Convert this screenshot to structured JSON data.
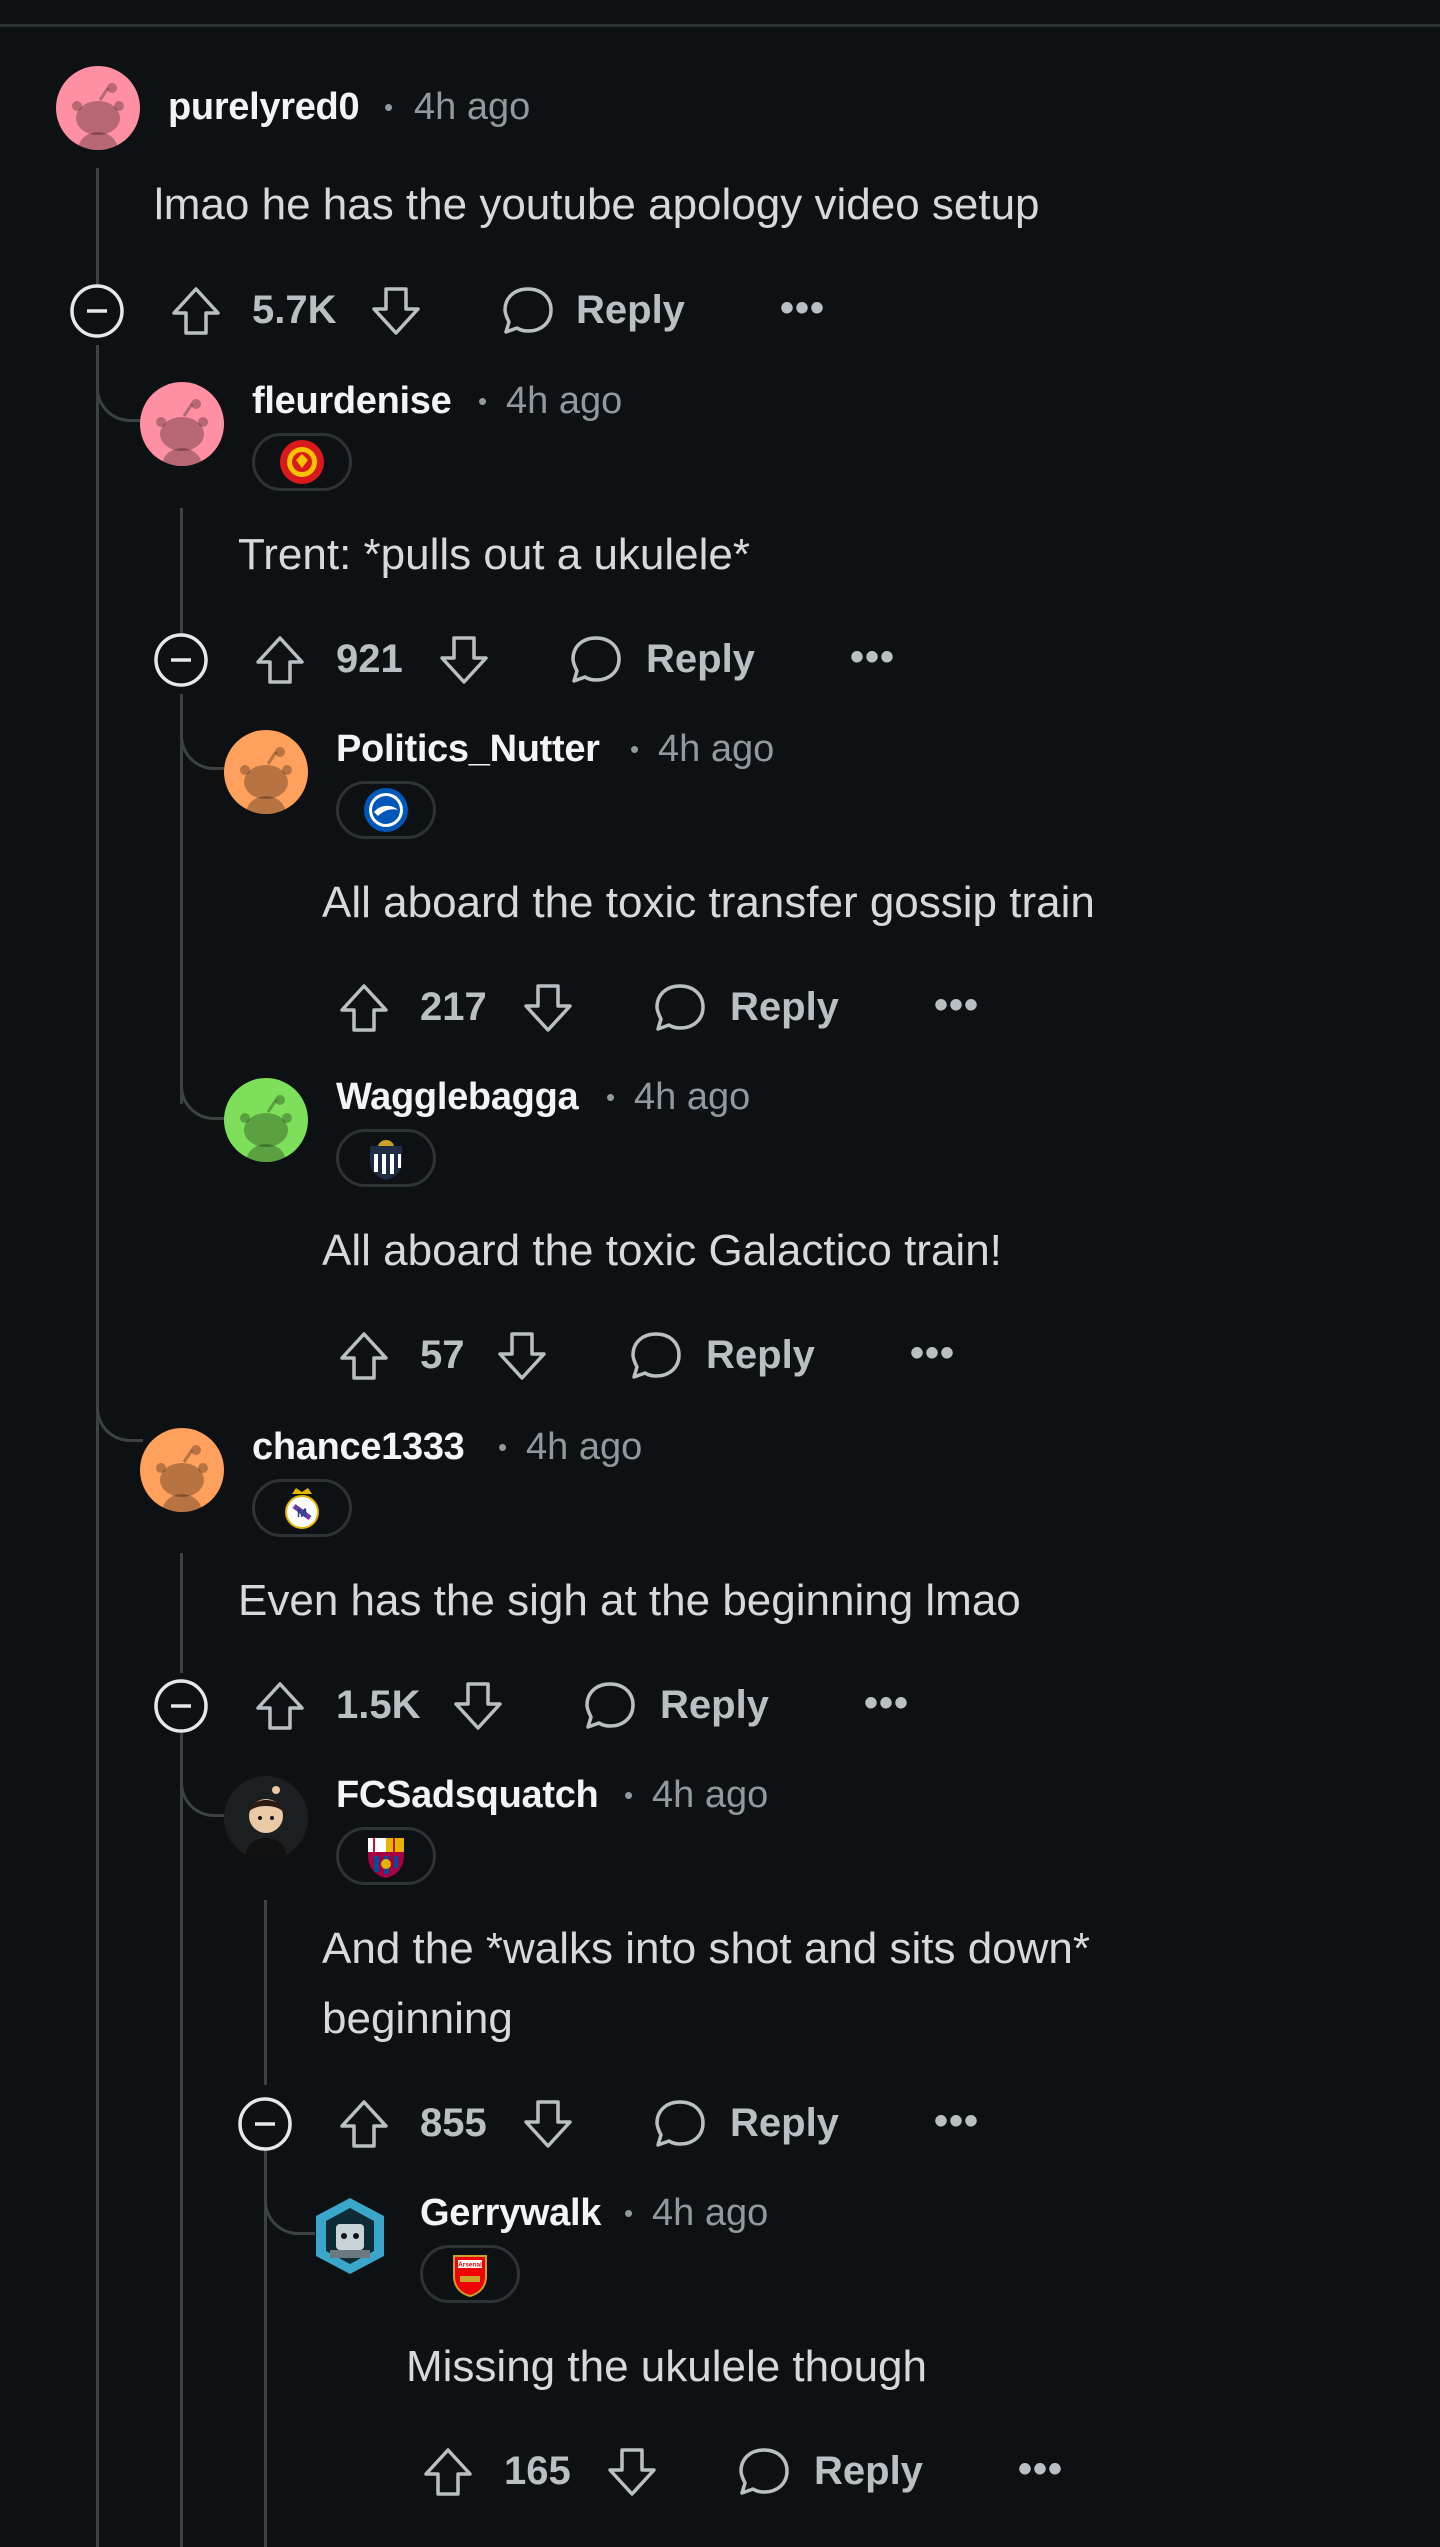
{
  "comments": [
    {
      "user": "purelyred0",
      "sep": "•",
      "time": "4h ago",
      "text": "lmao he has the youtube apology video setup",
      "votes": "5.7K",
      "reply": "Reply",
      "more": "•••",
      "avatar_color": "#ff8fa3",
      "flair": null
    },
    {
      "user": "fleurdenise",
      "sep": "•",
      "time": "4h ago",
      "text": "Trent: *pulls out a ukulele*",
      "votes": "921",
      "reply": "Reply",
      "more": "•••",
      "avatar_color": "#ff8fa3",
      "flair": "manchester-united-crest"
    },
    {
      "user": "Politics_Nutter",
      "sep": "•",
      "time": "4h ago",
      "text": "All aboard the toxic transfer gossip train",
      "votes": "217",
      "reply": "Reply",
      "more": "•••",
      "avatar_color": "#ffa05c",
      "flair": "brighton-crest"
    },
    {
      "user": "Wagglebagga",
      "sep": "•",
      "time": "4h ago",
      "text": "All aboard the toxic Galactico train!",
      "votes": "57",
      "reply": "Reply",
      "more": "•••",
      "avatar_color": "#7ee05a",
      "flair": "newcastle-crest"
    },
    {
      "user": "chance1333",
      "sep": "•",
      "time": "4h ago",
      "text": "Even has the sigh at the beginning lmao",
      "votes": "1.5K",
      "reply": "Reply",
      "more": "•••",
      "avatar_color": "#ffa05c",
      "flair": "real-madrid-crest"
    },
    {
      "user": "FCSadsquatch",
      "sep": "•",
      "time": "4h ago",
      "text1": "And the *walks into shot and sits down*",
      "text2": "beginning",
      "votes": "855",
      "reply": "Reply",
      "more": "•••",
      "avatar_color": "#1c1f21",
      "flair": "barcelona-crest"
    },
    {
      "user": "Gerrywalk",
      "sep": "•",
      "time": "4h ago",
      "text": "Missing the ukulele though",
      "votes": "165",
      "reply": "Reply",
      "more": "•••",
      "avatar_color": "#3aa6c9",
      "flair": "arsenal-crest",
      "flair_text": "Arsenal"
    }
  ],
  "colors": {
    "bg": "#0e1113",
    "text": "#d7dadc",
    "muted": "#8f999e",
    "thread": "#3a4246"
  }
}
